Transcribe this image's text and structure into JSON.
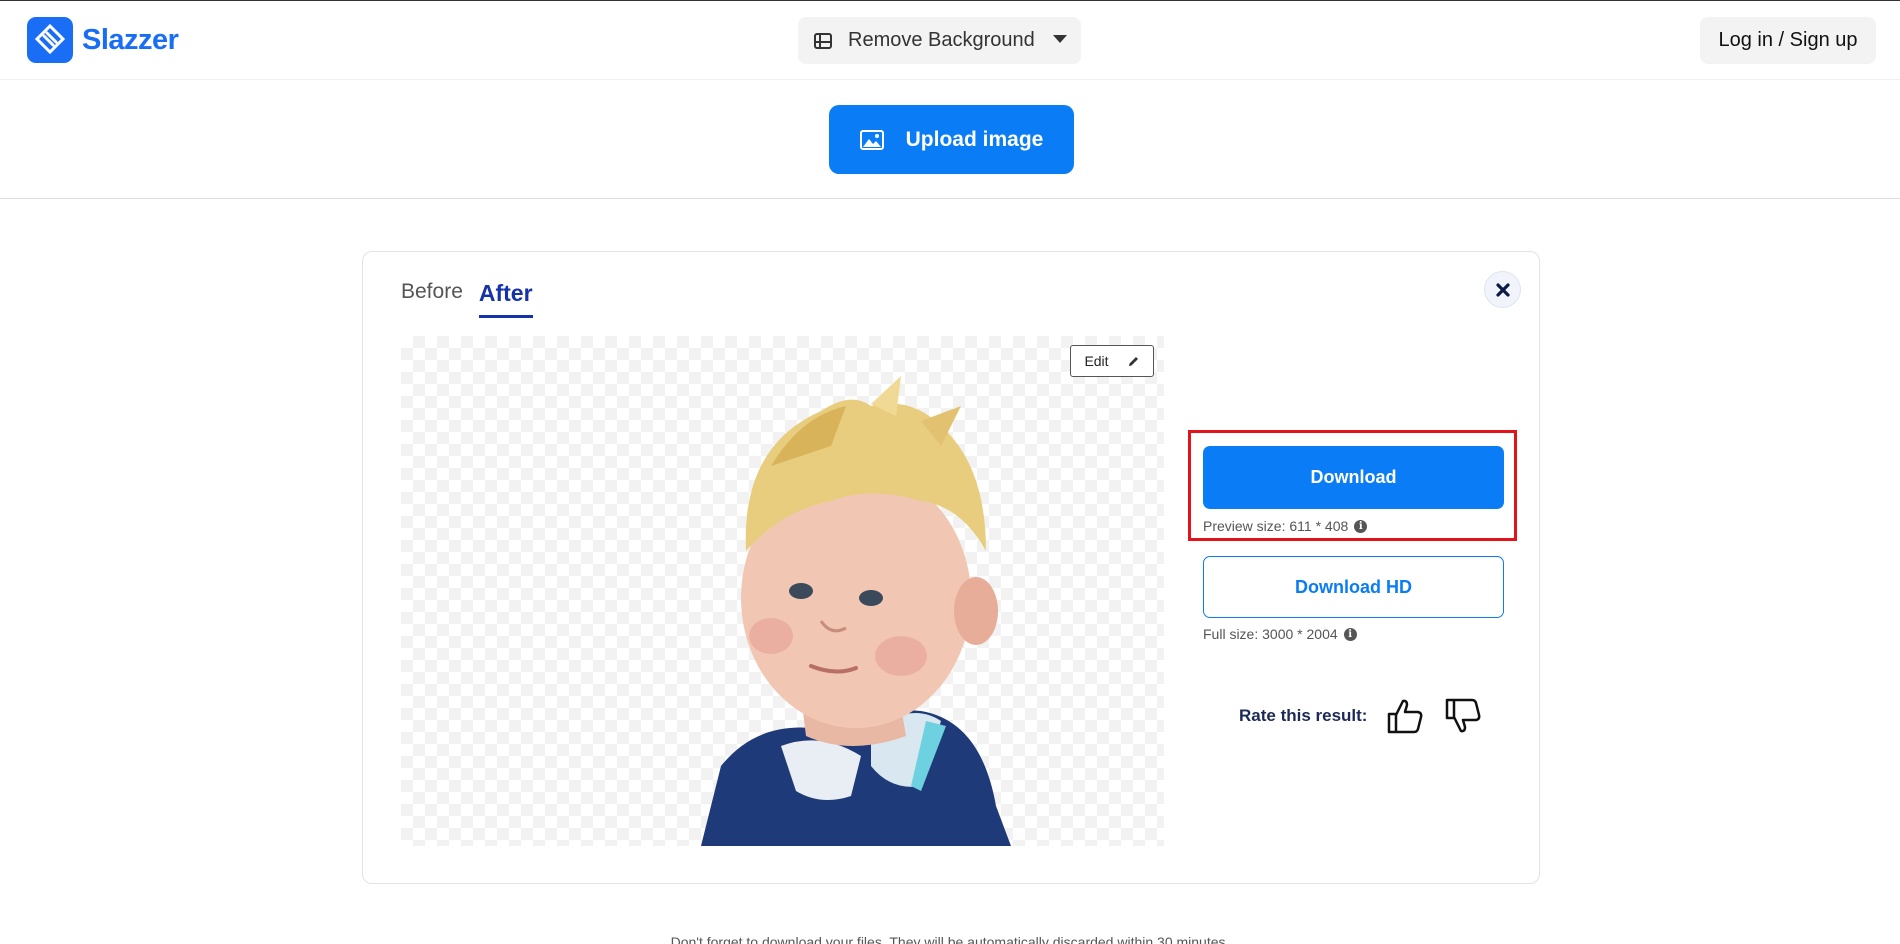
{
  "brand": {
    "name": "Slazzer",
    "color": "#1a6ef5"
  },
  "header": {
    "tool_select": {
      "label": "Remove Background",
      "icon": "crop-icon"
    },
    "login_label": "Log in / Sign up"
  },
  "upload": {
    "label": "Upload image",
    "icon": "image-icon",
    "color": "#0a7cf5"
  },
  "result": {
    "tabs": [
      {
        "label": "Before",
        "active": false
      },
      {
        "label": "After",
        "active": true
      }
    ],
    "edit_label": "Edit",
    "download_label": "Download",
    "preview_size": "Preview size: 611 * 408",
    "download_hd_label": "Download HD",
    "full_size": "Full size: 3000 * 2004",
    "rate_label": "Rate this result:",
    "highlight_color": "#e3131b"
  },
  "footnote": "Don't forget to download your files. They will be automatically discarded within 30 minutes."
}
